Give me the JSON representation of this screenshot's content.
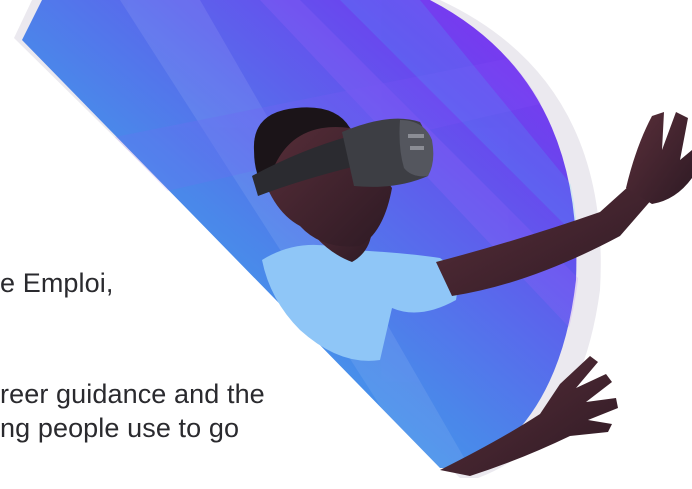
{
  "hero": {
    "image_subject": "person wearing vr headset reaching outward",
    "colors": {
      "ring": "#eceaf0",
      "gradient_start": "#36b8ef",
      "gradient_mid": "#5a6be8",
      "gradient_end": "#7a2df0",
      "text": "#2a2a2e"
    }
  },
  "text": {
    "line1": "e Emploi,",
    "line2": "reer guidance and the",
    "line3": "ng people use to go"
  }
}
